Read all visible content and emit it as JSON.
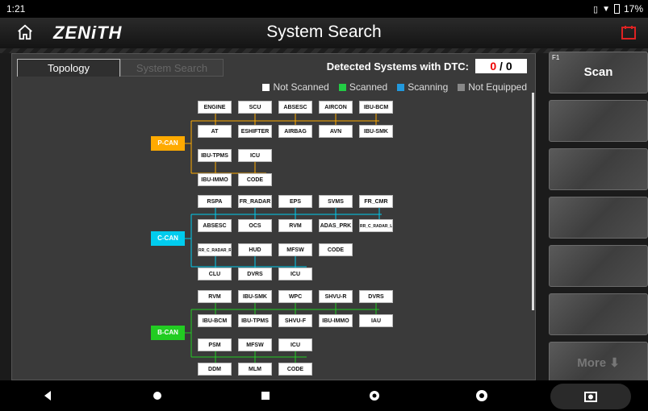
{
  "status": {
    "time": "1:21",
    "battery": "17%"
  },
  "header": {
    "logo": "ZENiTH",
    "title": "System Search"
  },
  "tabs": [
    {
      "label": "Topology"
    },
    {
      "label": "System Search"
    }
  ],
  "dtc": {
    "label": "Detected Systems with DTC:",
    "count": "0",
    "sep": " / ",
    "total": "0"
  },
  "legend": [
    {
      "label": "Not Scanned",
      "color": "#ffffff"
    },
    {
      "label": "Scanned",
      "color": "#22cc44"
    },
    {
      "label": "Scanning",
      "color": "#2299dd"
    },
    {
      "label": "Not Equipped",
      "color": "#888888"
    }
  ],
  "buses": {
    "pcan": {
      "label": "P-CAN",
      "color": "#ffaa00"
    },
    "ccan": {
      "label": "C-CAN",
      "color": "#00ccee"
    },
    "bcan": {
      "label": "B-CAN",
      "color": "#22cc22"
    }
  },
  "pcan_nodes": [
    "ENGINE",
    "SCU",
    "ABSESC",
    "AIRCON",
    "IBU-BCM",
    "AT",
    "ESHIFTER",
    "AIRBAG",
    "AVN",
    "IBU-SMK",
    "IBU-TPMS",
    "ICU",
    "IBU-IMMO",
    "CODE"
  ],
  "ccan_nodes": [
    "RSPA",
    "FR_RADAR",
    "EPS",
    "SVMS",
    "FR_CMR",
    "ABSESC",
    "OCS",
    "RVM",
    "ADAS_PRK",
    "RR_C_RADAR_L",
    "RR_C_RADAR_R",
    "HUD",
    "MFSW",
    "CODE",
    "CLU",
    "DVRS",
    "ICU"
  ],
  "bcan_nodes": [
    "RVM",
    "IBU-SMK",
    "WPC",
    "SHVU-R",
    "DVRS",
    "IBU-BCM",
    "IBU-TPMS",
    "SHVU-F",
    "IBU-IMMO",
    "IAU",
    "PSM",
    "MFSW",
    "ICU",
    "DDM",
    "MLM",
    "CODE"
  ],
  "sidebar": {
    "f1_key": "F1",
    "scan": "Scan",
    "more": "More ⬇"
  }
}
